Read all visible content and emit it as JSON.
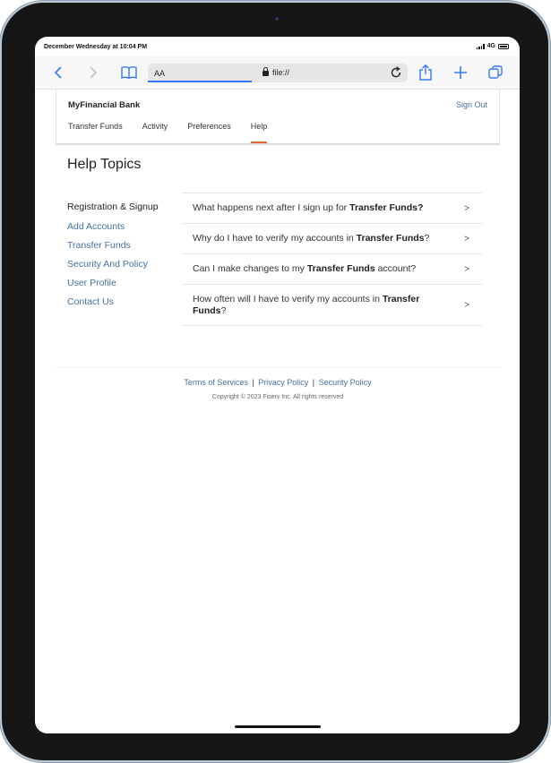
{
  "status": {
    "time": "December Wednesday at 10:04 PM",
    "network": "4G"
  },
  "browser": {
    "aa": "AA",
    "url": "file://",
    "icons": [
      "back-chevron-icon",
      "forward-chevron-icon",
      "book-icon",
      "lock-icon",
      "reload-icon",
      "share-icon",
      "plus-icon",
      "tabs-icon"
    ]
  },
  "app": {
    "brand": "MyFinancial Bank",
    "sign_out": "Sign Out",
    "tabs": [
      {
        "label": "Transfer Funds"
      },
      {
        "label": "Activity"
      },
      {
        "label": "Preferences"
      },
      {
        "label": "Help",
        "active": true
      }
    ]
  },
  "help": {
    "title": "Help Topics",
    "sidebar": [
      {
        "label": "Registration & Signup",
        "current": true
      },
      {
        "label": "Add Accounts"
      },
      {
        "label": "Transfer Funds"
      },
      {
        "label": "Security And Policy"
      },
      {
        "label": "User Profile"
      },
      {
        "label": "Contact Us"
      }
    ],
    "faqs": [
      {
        "pre": "What happens next after I sign up for ",
        "bold": "Transfer Funds?",
        "post": ""
      },
      {
        "pre": "Why do I have to verify my accounts in ",
        "bold": "Transfer Funds",
        "post": "?"
      },
      {
        "pre": "Can I make changes to my ",
        "bold": "Transfer Funds",
        "post": " account?"
      },
      {
        "pre": "How often will I have to verify my accounts in ",
        "bold": "Transfer Funds",
        "post": "?"
      }
    ],
    "chevron": ">"
  },
  "footer": {
    "terms": "Terms of Services",
    "privacy": "Privacy Policy",
    "security": "Security Policy",
    "separator": "|",
    "copyright": "Copyright © 2023 Fiserv Inc. All rights reserved"
  },
  "colors": {
    "link": "#45719e",
    "accent": "#e2683c",
    "safari_blue": "#3478f6"
  }
}
